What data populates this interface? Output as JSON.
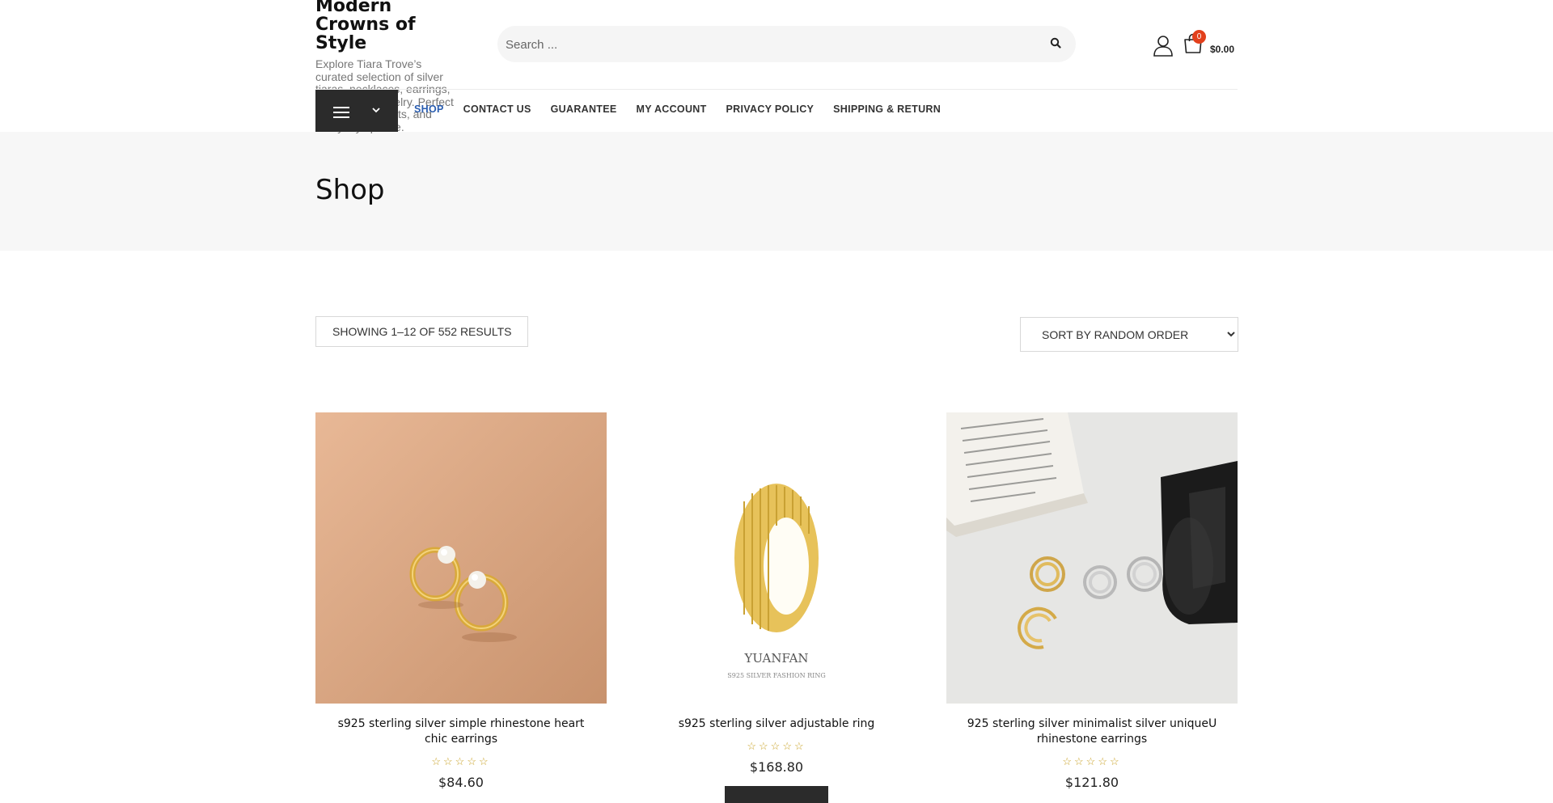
{
  "site": {
    "title": "Modern Crowns of Style",
    "description": "Explore Tiara Trove’s curated selection of silver tiaras, necklaces, earrings, and fashion jewelry. Perfect for weddings, gifts, and everyday sparkle."
  },
  "search": {
    "placeholder": "Search ...",
    "icon": "search-icon"
  },
  "cart": {
    "count": "0",
    "total": "$0.00"
  },
  "nav": [
    {
      "label": "SHOP",
      "active": true
    },
    {
      "label": "CONTACT US"
    },
    {
      "label": "GUARANTEE"
    },
    {
      "label": "MY ACCOUNT"
    },
    {
      "label": "PRIVACY POLICY"
    },
    {
      "label": "SHIPPING & RETURN"
    }
  ],
  "page": {
    "title": "Shop"
  },
  "toolbar": {
    "result_count": "SHOWING 1–12 OF 552 RESULTS",
    "sort_selected": "SORT BY RANDOM ORDER"
  },
  "products": [
    {
      "name": "s925 sterling silver simple rhinestone heart chic earrings",
      "rating": 0,
      "price": "$84.60"
    },
    {
      "name": "s925 sterling silver adjustable ring",
      "rating": 0,
      "price": "$168.80",
      "image_text": {
        "brand": "YUANFAN",
        "caption": "S925 SILVER FASHION RING"
      }
    },
    {
      "name": "925 sterling silver minimalist silver uniqueU rhinestone earrings",
      "rating": 0,
      "price": "$121.80"
    }
  ],
  "colors": {
    "accent": "#2a5db0",
    "cart_badge": "#e2401c",
    "dark": "#2b2b2b",
    "star": "#c9a227"
  }
}
